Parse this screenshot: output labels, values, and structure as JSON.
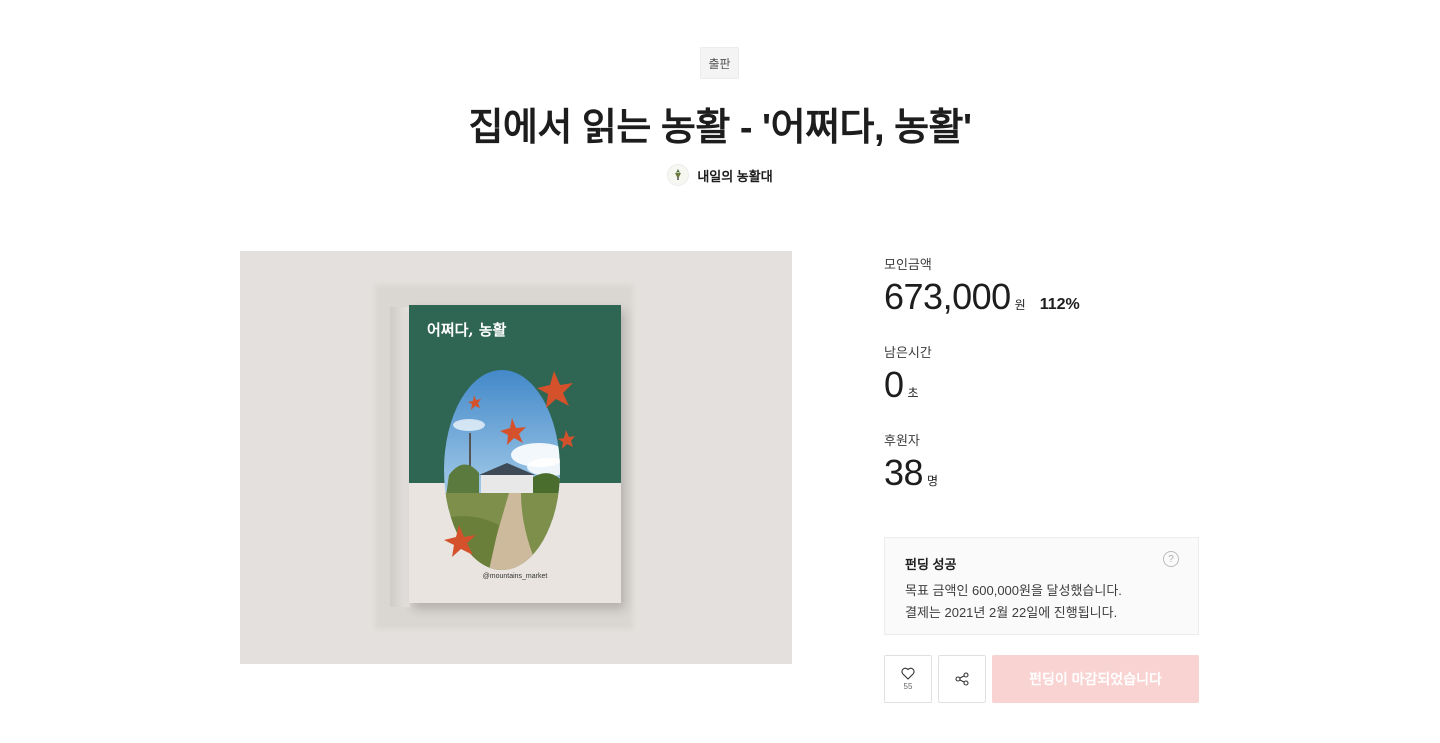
{
  "header": {
    "category": "출판",
    "title": "집에서 읽는 농활 - '어쩌다, 농활'",
    "creator_name": "내일의 농활대"
  },
  "book": {
    "cover_title": "어쩌다, 농활",
    "cover_handle": "@mountains_market",
    "colors": {
      "cover_top": "#2f6653",
      "cover_bottom": "#e9e4df",
      "background": "#e4e0dd",
      "star": "#d4512c"
    }
  },
  "stats": {
    "amount_label": "모인금액",
    "amount_value": "673,000",
    "amount_unit": "원",
    "amount_percent": "112%",
    "time_label": "남은시간",
    "time_value": "0",
    "time_unit": "초",
    "backers_label": "후원자",
    "backers_value": "38",
    "backers_unit": "명"
  },
  "success": {
    "title": "펀딩 성공",
    "help_icon": "?",
    "line1": "목표 금액인 600,000원을 달성했습니다.",
    "line2": "결제는 2021년 2월 22일에 진행됩니다."
  },
  "actions": {
    "like_count": "55",
    "closed_label": "펀딩이 마감되었습니다",
    "closed_color": "#f8d3d2"
  }
}
